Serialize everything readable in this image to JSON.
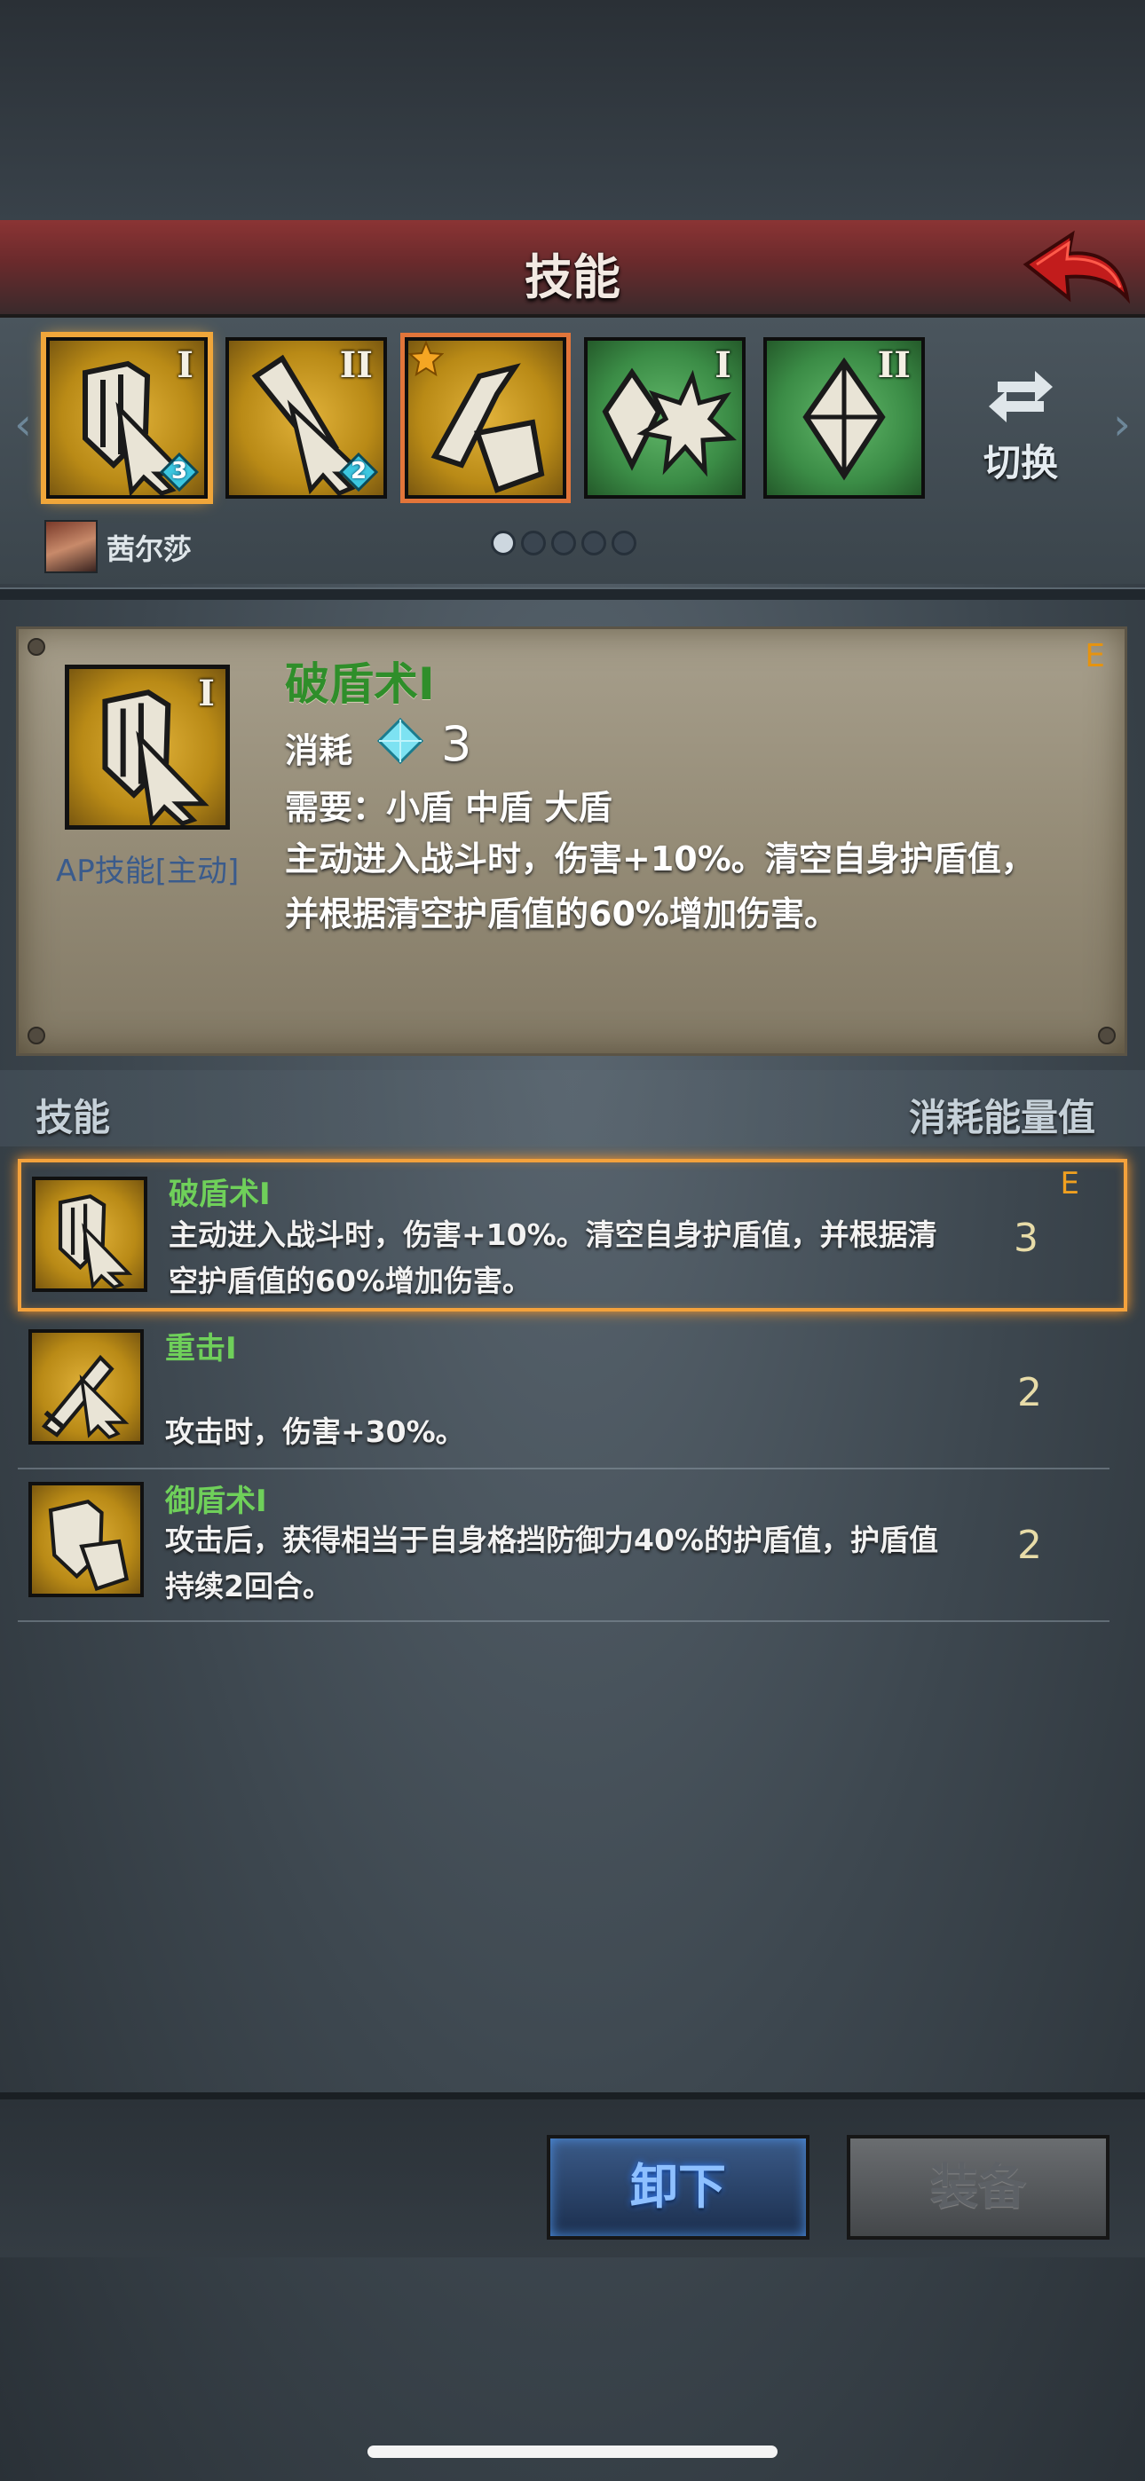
{
  "header": {
    "title": "技能"
  },
  "skill_slots": [
    {
      "roman": "I",
      "badge": "3",
      "color": "gold",
      "icon": "shield-break-icon"
    },
    {
      "roman": "II",
      "badge": "2",
      "color": "gold",
      "icon": "sword-strike-icon"
    },
    {
      "roman": "",
      "badge": "",
      "color": "gold",
      "icon": "shield-guard-icon",
      "starred": true
    },
    {
      "roman": "I",
      "badge": "",
      "color": "green",
      "icon": "crystal-burst-icon"
    },
    {
      "roman": "II",
      "badge": "",
      "color": "green",
      "icon": "crystal-icon"
    }
  ],
  "switch": {
    "label": "切换"
  },
  "character": {
    "name": "茜尔莎"
  },
  "pager": {
    "total": 5,
    "active": 0
  },
  "detail": {
    "name": "破盾术I",
    "rank": "E",
    "type": "AP技能[主动]",
    "cost_label": "消耗",
    "cost_value": "3",
    "require": "需要：小盾 中盾 大盾",
    "description": "主动进入战斗时，伤害+10%。清空自身护盾值，并根据清空护盾值的60%增加伤害。"
  },
  "list": {
    "header_left": "技能",
    "header_right": "消耗能量值",
    "rows": [
      {
        "name": "破盾术I",
        "desc": "主动进入战斗时，伤害+10%。清空自身护盾值，并根据清空护盾值的60%增加伤害。",
        "cost": "3",
        "rank": "E"
      },
      {
        "name": "重击I",
        "desc": "攻击时，伤害+30%。",
        "cost": "2",
        "rank": ""
      },
      {
        "name": "御盾术I",
        "desc": "攻击后，获得相当于自身格挡防御力40%的护盾值，护盾值持续2回合。",
        "cost": "2",
        "rank": ""
      }
    ]
  },
  "buttons": {
    "unequip": "卸下",
    "equip": "装备"
  },
  "colors": {
    "accent_green": "#2f8e2a",
    "selected_orange": "#f4a23c",
    "rank_orange": "#e59310"
  }
}
